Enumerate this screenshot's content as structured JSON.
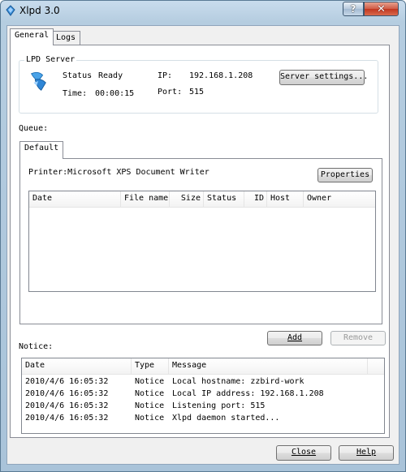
{
  "window": {
    "title": "Xlpd 3.0",
    "help_glyph": "?",
    "close_glyph": "✕"
  },
  "tabs": [
    {
      "label": "General",
      "active": true
    },
    {
      "label": "Logs",
      "active": false
    }
  ],
  "lpd_server": {
    "group_title": "LPD Server",
    "status_label": "Status",
    "status_value": "Ready",
    "time_label": "Time:",
    "time_value": "00:00:15",
    "ip_label": "IP:",
    "ip_value": "192.168.1.208",
    "port_label": "Port:",
    "port_value": "515",
    "settings_button": "Server settings..."
  },
  "queue": {
    "label": "Queue:",
    "tabs": [
      {
        "label": "Default"
      }
    ],
    "printer_label": "Printer:Microsoft XPS Document Writer",
    "properties_button": "Properties",
    "columns": [
      "Date",
      "File name",
      "Size",
      "Status",
      "ID",
      "Host",
      "Owner"
    ],
    "rows": [],
    "add_button": "Add",
    "remove_button": "Remove"
  },
  "notice": {
    "label": "Notice:",
    "columns": [
      "Date",
      "Type",
      "Message"
    ],
    "rows": [
      {
        "date": "2010/4/6 16:05:32",
        "type": "Notice",
        "message": "Local hostname: zzbird-work"
      },
      {
        "date": "2010/4/6 16:05:32",
        "type": "Notice",
        "message": "Local IP address: 192.168.1.208"
      },
      {
        "date": "2010/4/6 16:05:32",
        "type": "Notice",
        "message": "Listening port: 515"
      },
      {
        "date": "2010/4/6 16:05:32",
        "type": "Notice",
        "message": "Xlpd daemon started..."
      }
    ]
  },
  "footer": {
    "close_button": "Close",
    "help_button": "Help"
  }
}
